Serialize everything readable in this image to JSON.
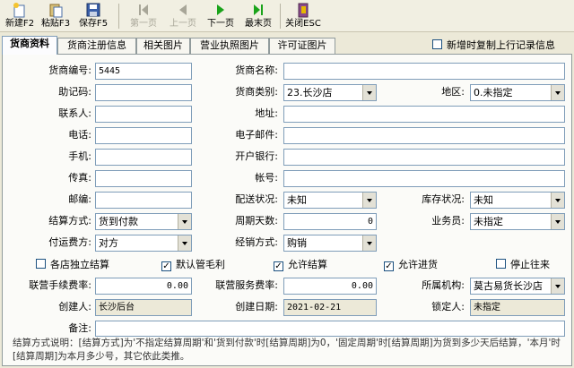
{
  "toolbar": {
    "new_label": "新建F2",
    "paste_label": "粘贴F3",
    "save_label": "保存F5",
    "first_label": "第一页",
    "prev_label": "上一页",
    "next_label": "下一页",
    "last_label": "最末页",
    "close_label": "关闭ESC"
  },
  "tabs": [
    "货商资料",
    "货商注册信息",
    "相关图片",
    "营业执照图片",
    "许可证图片"
  ],
  "copy_prev_label": "新增时复制上行记录信息",
  "form": {
    "code_label": "货商编号:",
    "code_value": "5445",
    "name_label": "货商名称:",
    "name_value": "",
    "mnemonic_label": "助记码:",
    "mnemonic_value": "",
    "category_label": "货商类别:",
    "category_value": "23.长沙店",
    "region_label": "地区:",
    "region_value": "0.未指定",
    "contact_label": "联系人:",
    "contact_value": "",
    "address_label": "地址:",
    "address_value": "",
    "phone_label": "电话:",
    "phone_value": "",
    "email_label": "电子邮件:",
    "email_value": "",
    "mobile_label": "手机:",
    "mobile_value": "",
    "bank_label": "开户银行:",
    "bank_value": "",
    "fax_label": "传真:",
    "fax_value": "",
    "account_label": "帐号:",
    "account_value": "",
    "postcode_label": "邮编:",
    "postcode_value": "",
    "delivery_label": "配送状况:",
    "delivery_value": "未知",
    "stock_label": "库存状况:",
    "stock_value": "未知",
    "settle_label": "结算方式:",
    "settle_value": "货到付款",
    "period_label": "周期天数:",
    "period_value": "0",
    "salesman_label": "业务员:",
    "salesman_value": "未指定",
    "freight_label": "付运费方:",
    "freight_value": "对方",
    "sales_mode_label": "经销方式:",
    "sales_mode_value": "购销",
    "fee_rate_label": "联营手续费率:",
    "fee_rate_value": "0.00",
    "service_rate_label": "联营服务费率:",
    "service_rate_value": "0.00",
    "org_label": "所属机构:",
    "org_value": "莫古易货长沙店",
    "creator_label": "创建人:",
    "creator_value": "长沙后台",
    "created_label": "创建日期:",
    "created_value": "2021-02-21",
    "locker_label": "锁定人:",
    "locker_value": "未指定",
    "remark_label": "备注:",
    "remark_value": ""
  },
  "checks": {
    "independent": {
      "label": "各店独立结算",
      "checked": false
    },
    "default_margin": {
      "label": "默认管毛利",
      "checked": true
    },
    "allow_settle": {
      "label": "允许结算",
      "checked": true
    },
    "allow_purchase": {
      "label": "允许进货",
      "checked": true
    },
    "stop_trade": {
      "label": "停止往来",
      "checked": false
    }
  },
  "note": "结算方式说明：[结算方式]为'不指定结算周期'和'货到付款'时[结算周期]为0，'固定周期'时[结算周期]为货到多少天后结算，'本月'时[结算周期]为本月多少号，其它依此类推。",
  "colors": {
    "accent": "#7f9db9",
    "toolbar_bg": "#f1efe2",
    "panel_bg": "#fbfbf8"
  }
}
